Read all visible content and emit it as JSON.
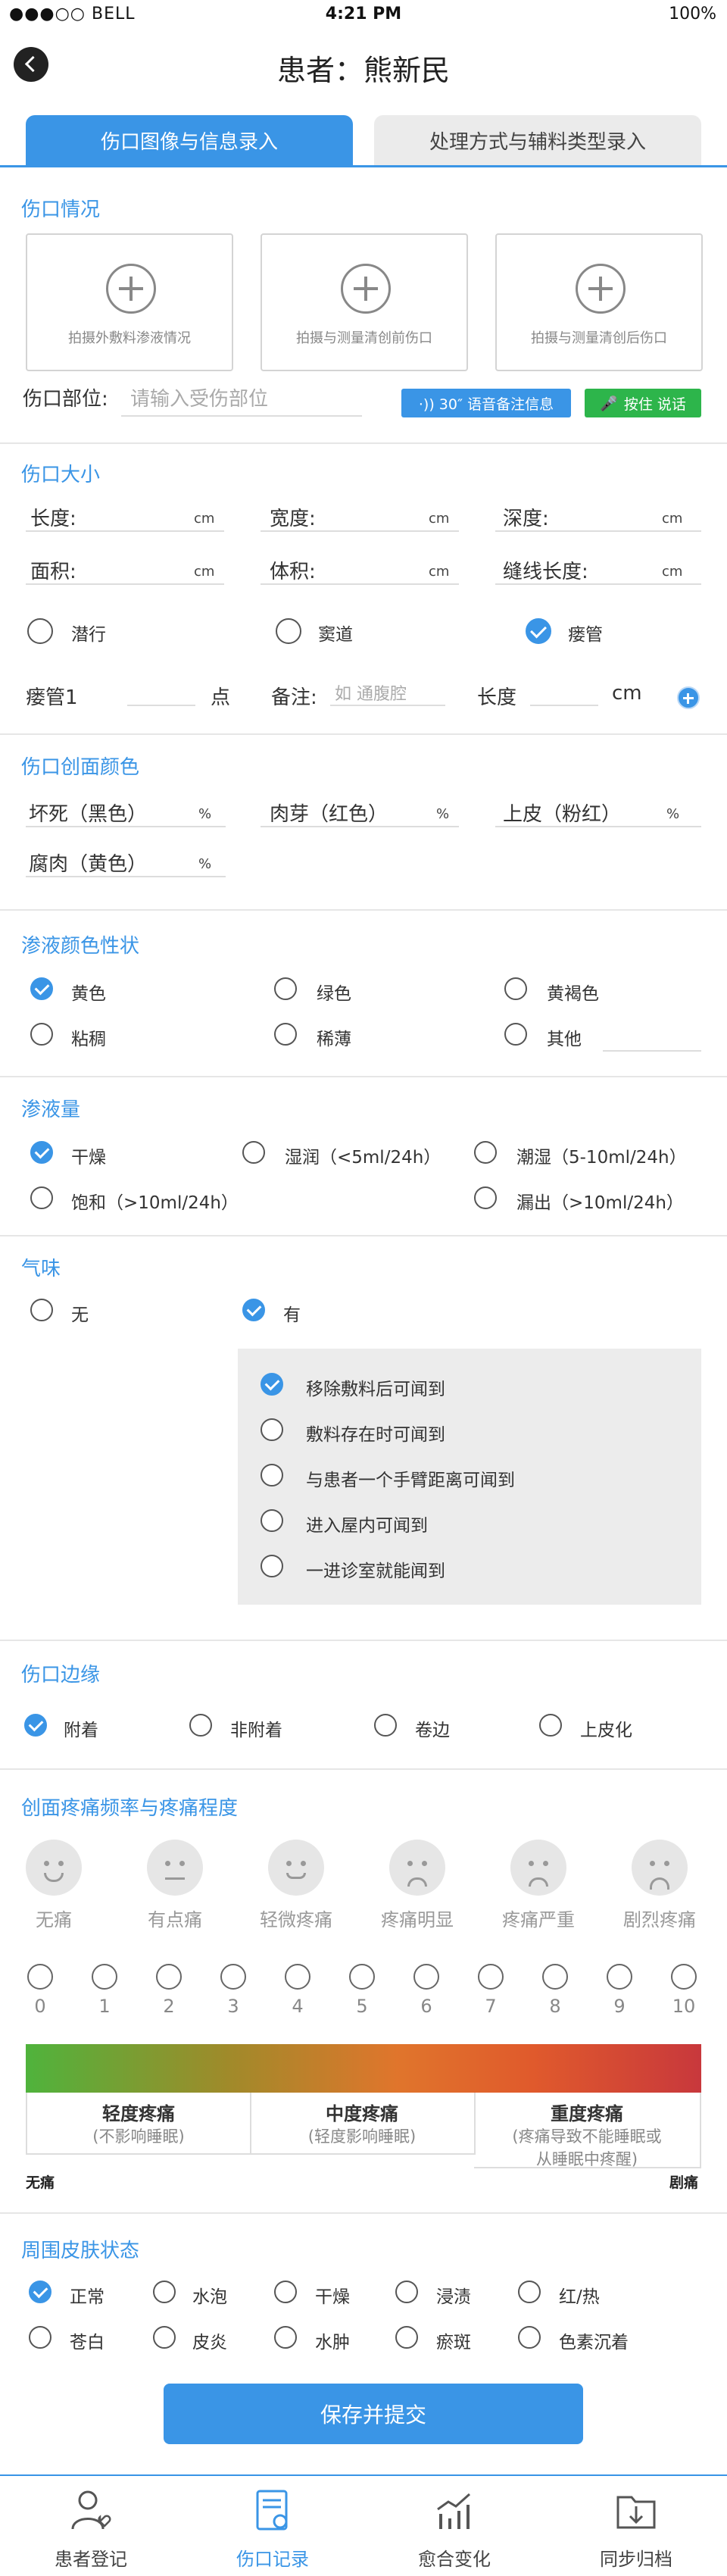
{
  "status_bar": {
    "carrier": "●●●○○ BELL",
    "time": "4:21 PM",
    "battery": "100%"
  },
  "header": {
    "title": "患者：熊新民"
  },
  "tabs": [
    {
      "label": "伤口图像与信息录入",
      "active": true
    },
    {
      "label": "处理方式与辅料类型录入",
      "active": false
    }
  ],
  "wound": {
    "section": "伤口情况",
    "photos": [
      "拍摄外敷料渗液情况",
      "拍摄与测量清创前伤口",
      "拍摄与测量清创后伤口"
    ],
    "site_label": "伤口部位:",
    "site_placeholder": "请输入受伤部位",
    "voice_btn": "·)) 30″ 语音备注信息",
    "talk_btn": "按住 说话"
  },
  "size": {
    "section": "伤口大小",
    "fields": [
      {
        "label": "长度:",
        "unit": "cm"
      },
      {
        "label": "宽度:",
        "unit": "cm"
      },
      {
        "label": "深度:",
        "unit": "cm"
      },
      {
        "label": "面积:",
        "unit": "cm"
      },
      {
        "label": "体积:",
        "unit": "cm"
      },
      {
        "label": "缝线长度:",
        "unit": "cm"
      }
    ],
    "tunnel_options": [
      {
        "label": "潜行",
        "checked": false
      },
      {
        "label": "窦道",
        "checked": false
      },
      {
        "label": "瘘管",
        "checked": true
      }
    ],
    "fistula_label": "瘘管1",
    "point_unit": "点",
    "note_label": "备注:",
    "note_placeholder": "如 通腹腔",
    "length_label": "长度",
    "length_unit": "cm"
  },
  "color": {
    "section": "伤口创面颜色",
    "fields": [
      {
        "label": "坏死（黑色）",
        "unit": "%"
      },
      {
        "label": "肉芽（红色）",
        "unit": "%"
      },
      {
        "label": "上皮（粉红）",
        "unit": "%"
      },
      {
        "label": "腐肉（黄色）",
        "unit": "%"
      }
    ]
  },
  "exudate_color": {
    "section": "渗液颜色性状",
    "options": [
      {
        "label": "黄色",
        "checked": true
      },
      {
        "label": "绿色",
        "checked": false
      },
      {
        "label": "黄褐色",
        "checked": false
      },
      {
        "label": "粘稠",
        "checked": false
      },
      {
        "label": "稀薄",
        "checked": false
      },
      {
        "label": "其他",
        "checked": false
      }
    ]
  },
  "exudate_amount": {
    "section": "渗液量",
    "options": [
      {
        "label": "干燥",
        "checked": true
      },
      {
        "label": "湿润（<5ml/24h）",
        "checked": false
      },
      {
        "label": "潮湿（5-10ml/24h）",
        "checked": false
      },
      {
        "label": "饱和（>10ml/24h）",
        "checked": false
      },
      {
        "label": "漏出（>10ml/24h）",
        "checked": false
      }
    ]
  },
  "odor": {
    "section": "气味",
    "options": [
      {
        "label": "无",
        "checked": false
      },
      {
        "label": "有",
        "checked": true
      }
    ],
    "sub_options": [
      {
        "label": "移除敷料后可闻到",
        "checked": true
      },
      {
        "label": "敷料存在时可闻到",
        "checked": false
      },
      {
        "label": "与患者一个手臂距离可闻到",
        "checked": false
      },
      {
        "label": "进入屋内可闻到",
        "checked": false
      },
      {
        "label": "一进诊室就能闻到",
        "checked": false
      }
    ]
  },
  "edge": {
    "section": "伤口边缘",
    "options": [
      {
        "label": "附着",
        "checked": true
      },
      {
        "label": "非附着",
        "checked": false
      },
      {
        "label": "卷边",
        "checked": false
      },
      {
        "label": "上皮化",
        "checked": false
      }
    ]
  },
  "pain": {
    "section": "创面疼痛频率与疼痛程度",
    "faces": [
      {
        "label": "无痛",
        "icon": "face-smile-icon"
      },
      {
        "label": "有点痛",
        "icon": "face-neutral-icon"
      },
      {
        "label": "轻微疼痛",
        "icon": "face-slight-icon"
      },
      {
        "label": "疼痛明显",
        "icon": "face-sad-icon"
      },
      {
        "label": "疼痛严重",
        "icon": "face-worried-icon"
      },
      {
        "label": "剧烈疼痛",
        "icon": "face-crying-icon"
      }
    ],
    "scale": [
      "0",
      "1",
      "2",
      "3",
      "4",
      "5",
      "6",
      "7",
      "8",
      "9",
      "10"
    ],
    "levels": [
      {
        "title": "轻度疼痛",
        "desc": "(不影响睡眠)"
      },
      {
        "title": "中度疼痛",
        "desc": "(轻度影响睡眠)"
      },
      {
        "title": "重度疼痛",
        "desc": "(疼痛导致不能睡眠或从睡眠中疼醒)"
      }
    ],
    "left_end": "无痛",
    "right_end": "剧痛"
  },
  "skin": {
    "section": "周围皮肤状态",
    "options": [
      {
        "label": "正常",
        "checked": true
      },
      {
        "label": "水泡",
        "checked": false
      },
      {
        "label": "干燥",
        "checked": false
      },
      {
        "label": "浸渍",
        "checked": false
      },
      {
        "label": "红/热",
        "checked": false
      },
      {
        "label": "苍白",
        "checked": false
      },
      {
        "label": "皮炎",
        "checked": false
      },
      {
        "label": "水肿",
        "checked": false
      },
      {
        "label": "瘀斑",
        "checked": false
      },
      {
        "label": "色素沉着",
        "checked": false
      }
    ]
  },
  "submit_label": "保存并提交",
  "nav": [
    {
      "label": "患者登记",
      "active": false
    },
    {
      "label": "伤口记录",
      "active": true
    },
    {
      "label": "愈合变化",
      "active": false
    },
    {
      "label": "同步归档",
      "active": false
    }
  ],
  "colors": {
    "accent": "#3a95e6",
    "green": "#2db54b"
  }
}
